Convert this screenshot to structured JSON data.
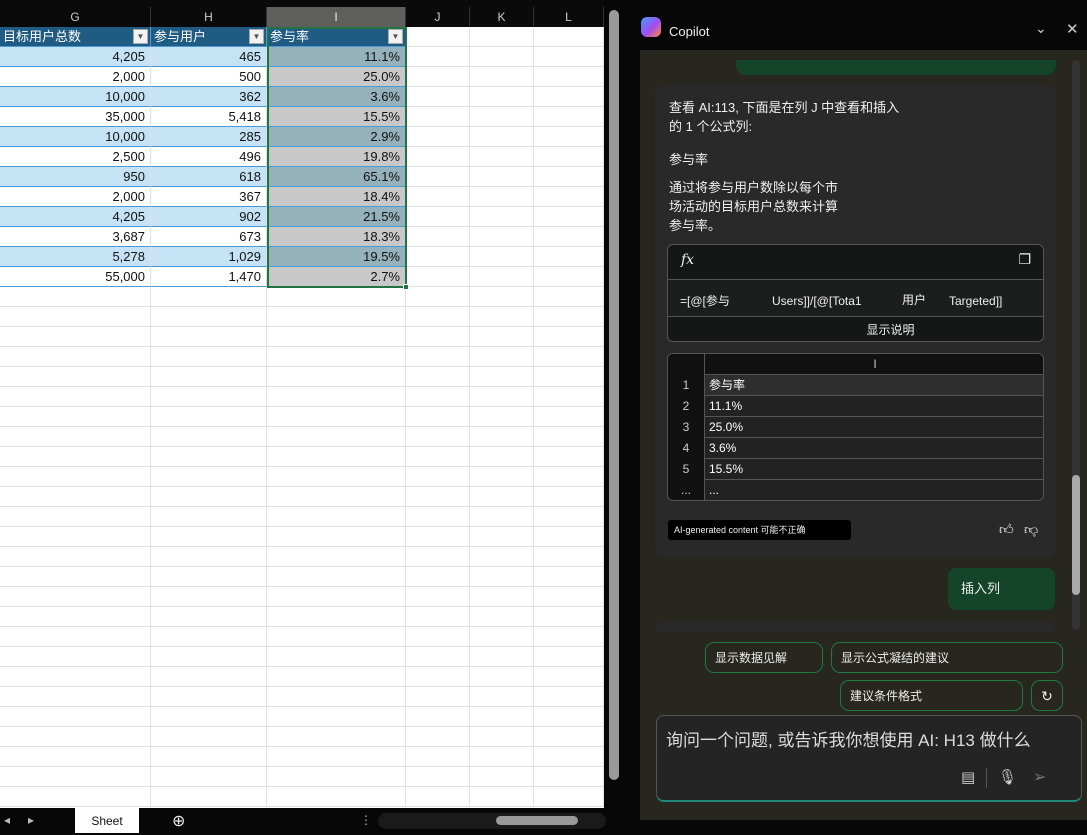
{
  "sheet": {
    "columns": [
      "G",
      "H",
      "I",
      "J",
      "K",
      "L"
    ],
    "headers": [
      "目标用户总数",
      "参与用户",
      "参与率"
    ],
    "rows": [
      [
        "4,205",
        "465",
        "11.1%"
      ],
      [
        "2,000",
        "500",
        "25.0%"
      ],
      [
        "10,000",
        "362",
        "3.6%"
      ],
      [
        "35,000",
        "5,418",
        "15.5%"
      ],
      [
        "10,000",
        "285",
        "2.9%"
      ],
      [
        "2,500",
        "496",
        "19.8%"
      ],
      [
        "950",
        "618",
        "65.1%"
      ],
      [
        "2,000",
        "367",
        "18.4%"
      ],
      [
        "4,205",
        "902",
        "21.5%"
      ],
      [
        "3,687",
        "673",
        "18.3%"
      ],
      [
        "5,278",
        "1,029",
        "19.5%"
      ],
      [
        "55,000",
        "1,470",
        "2.7%"
      ]
    ],
    "tab": "Sheet"
  },
  "copilot": {
    "title": "Copilot",
    "msg_line1": "查看 AI:113, 下面是在列 J 中查看和插入",
    "msg_line2": "的 1 个公式列:",
    "col_name": "参与率",
    "desc1": "通过将参与用户数除以每个市",
    "desc2": "场活动的目标用户总数来计算",
    "desc3": "参与率。",
    "fx": "fx",
    "formula": [
      "=[@[参与",
      "Users]]/[@[Tota1",
      "用户",
      "Targeted]]"
    ],
    "show_explain": "显示说明",
    "preview_col": "I",
    "preview": [
      [
        "1",
        "参与率"
      ],
      [
        "2",
        "11.1%"
      ],
      [
        "3",
        "25.0%"
      ],
      [
        "4",
        "3.6%"
      ],
      [
        "5",
        "15.5%"
      ],
      [
        "...",
        "..."
      ]
    ],
    "disclaimer": "AI-generated content 可能不正确",
    "user_msg": "插入列",
    "suggestions": [
      "显示数据见解",
      "显示公式凝结的建议",
      "建议条件格式"
    ],
    "placeholder": "询问一个问题, 或告诉我你想使用 AI: H13 做什么"
  }
}
